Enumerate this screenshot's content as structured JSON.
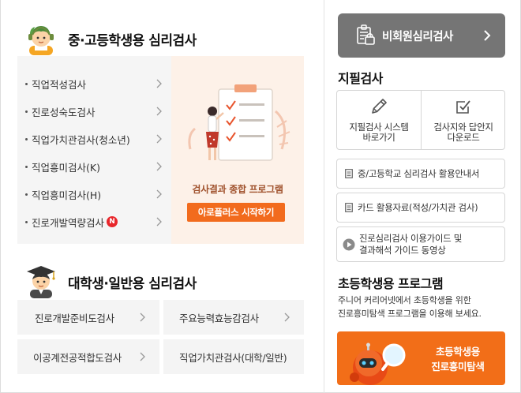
{
  "middle_high": {
    "title": "중·고등학생용 심리검사",
    "tests": [
      {
        "label": "직업적성검사"
      },
      {
        "label": "진로성숙도검사"
      },
      {
        "label": "직업가치관검사(청소년)"
      },
      {
        "label": "직업흥미검사(K)"
      },
      {
        "label": "직업흥미검사(H)"
      },
      {
        "label": "진로개발역량검사",
        "badge": "N"
      }
    ],
    "promo": {
      "caption": "검사결과 종합 프로그램",
      "button": "아로플러스 시작하기"
    }
  },
  "college": {
    "title": "대학생·일반용 심리검사",
    "tests": [
      {
        "label": "진로개발준비도검사"
      },
      {
        "label": "주요능력효능감검사"
      },
      {
        "label": "이공계전공적합도검사"
      },
      {
        "label": "직업가치관검사(대학/일반)"
      }
    ]
  },
  "sidebar": {
    "nonmember_button": "비회원심리검사",
    "paper_title": "지필검사",
    "paper_items": [
      {
        "label_line1": "지필검사 시스템",
        "label_line2": "바로가기",
        "icon": "pencil-icon"
      },
      {
        "label_line1": "검사지와 답안지",
        "label_line2": "다운로드",
        "icon": "checkbox-icon"
      }
    ],
    "links": [
      {
        "label": "중/고등학교 심리검사 활용안내서",
        "icon": "document-icon"
      },
      {
        "label": "카드 활용자료(적성/가치관 검사)",
        "icon": "document-icon"
      },
      {
        "label_line1": "진로심리검사 이용가이드 및",
        "label_line2": "결과해석 가이드 동영상",
        "icon": "play-icon"
      }
    ],
    "elementary": {
      "title": "초등학생용 프로그램",
      "desc_line1": "주니어 커리어넷에서 초등학생을 위한",
      "desc_line2": "진로흥미탐색 프로그램을 이용해 보세요.",
      "banner_line1": "초등학생용",
      "banner_line2": "진로흥미탐색"
    }
  },
  "colors": {
    "accent_orange": "#f26b1d",
    "badge_red": "#e8262b",
    "nonmember_gray": "#757575",
    "promo_bg": "#fdf1e8"
  }
}
